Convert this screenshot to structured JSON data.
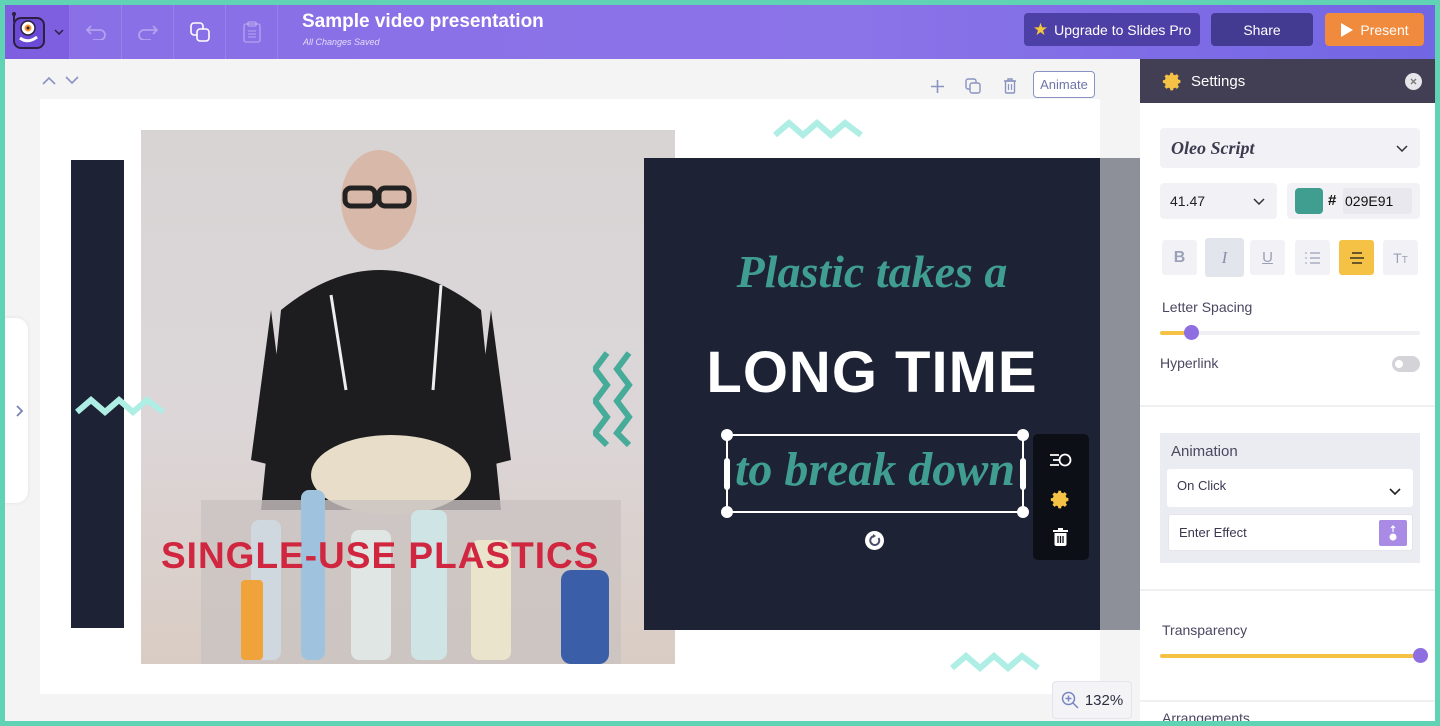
{
  "topbar": {
    "title": "Sample video presentation",
    "status": "All Changes Saved",
    "upgrade_label": "Upgrade to Slides Pro",
    "share_label": "Share",
    "present_label": "Present"
  },
  "canvas": {
    "animate_label": "Animate",
    "zoom_level": "132%",
    "slide": {
      "heading_script": "Plastic takes a",
      "heading_bold": "LONG TIME",
      "selected_text": "to break down",
      "photo_caption": "SINGLE-USE PLASTICS"
    }
  },
  "settings": {
    "title": "Settings",
    "font_family": "Oleo Script",
    "font_size": "41.47",
    "color_hash": "#",
    "color_hex": "029E91",
    "color_swatch": "#3f9e8f",
    "letter_spacing_label": "Letter Spacing",
    "letter_spacing_value": 0.12,
    "hyperlink_label": "Hyperlink",
    "hyperlink_on": false,
    "animation_label": "Animation",
    "animation_trigger": "On Click",
    "enter_effect_label": "Enter Effect",
    "transparency_label": "Transparency",
    "transparency_value": 1.0,
    "arrangements_label": "Arrangements"
  },
  "colors": {
    "accent_purple": "#8e6ee0",
    "present_orange": "#f08a3c",
    "teal_text": "#3f9e8f",
    "caption_red": "#d0263f",
    "slide_navy": "#1e2235",
    "active_yellow": "#f5c246"
  }
}
